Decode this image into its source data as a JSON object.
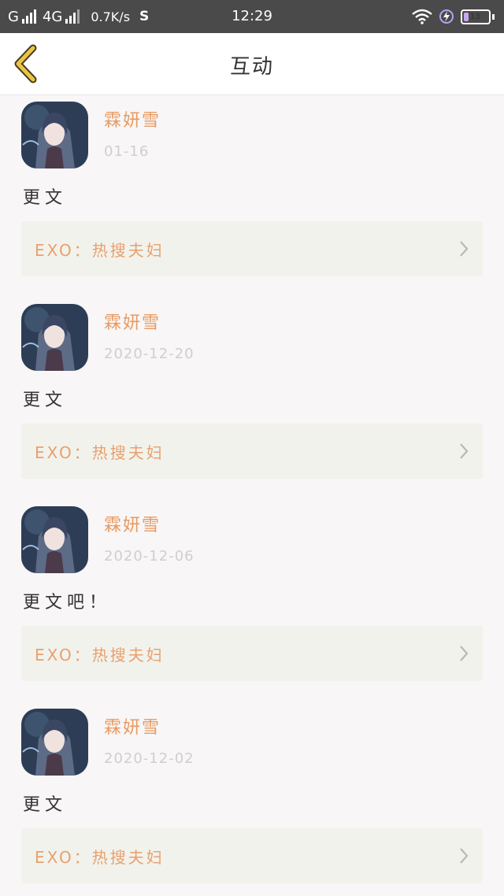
{
  "status_bar": {
    "carrier_1": "G",
    "carrier_2": "4G",
    "net_speed": "0.7K/s",
    "app_icon": "S",
    "time": "12:29",
    "battery": "13"
  },
  "nav": {
    "title": "互动",
    "back_icon": "chevron-left-icon"
  },
  "colors": {
    "accent": "#e89a62",
    "back_arrow": "#e8c548",
    "card_bg": "#f2f2ec"
  },
  "posts": [
    {
      "username": "霖妍雪",
      "date": "01-16",
      "content": "更文",
      "book": "EXO：热搜夫妇"
    },
    {
      "username": "霖妍雪",
      "date": "2020-12-20",
      "content": "更文",
      "book": "EXO：热搜夫妇"
    },
    {
      "username": "霖妍雪",
      "date": "2020-12-06",
      "content": "更文吧！",
      "book": "EXO：热搜夫妇"
    },
    {
      "username": "霖妍雪",
      "date": "2020-12-02",
      "content": "更文",
      "book": "EXO：热搜夫妇"
    }
  ]
}
